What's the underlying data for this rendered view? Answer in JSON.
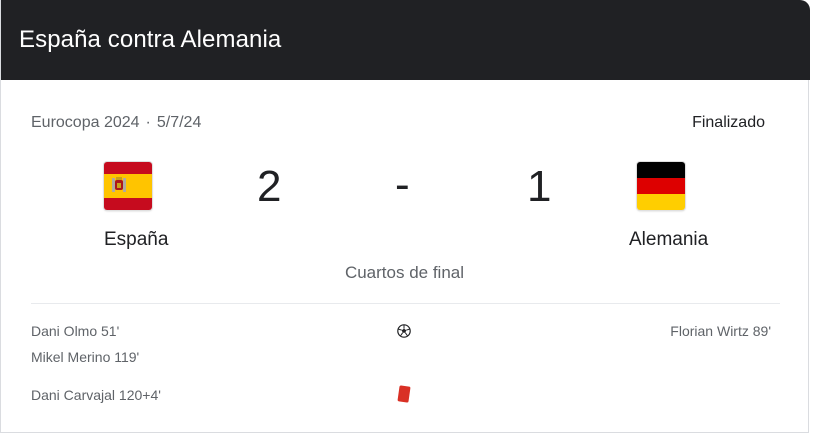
{
  "header": {
    "title": "España contra Alemania"
  },
  "match": {
    "competition": "Eurocopa 2024",
    "separator": "·",
    "date": "5/7/24",
    "status": "Finalizado",
    "round": "Cuartos de final",
    "score_separator": "-"
  },
  "home": {
    "name": "España",
    "score": "2",
    "flag_icon": "spain-flag-icon"
  },
  "away": {
    "name": "Alemania",
    "score": "1",
    "flag_icon": "germany-flag-icon"
  },
  "events": {
    "goals": {
      "icon": "soccer-ball-icon",
      "home": [
        "Dani Olmo 51'",
        "Mikel Merino 119'"
      ],
      "away": [
        "Florian Wirtz 89'"
      ]
    },
    "red_cards": {
      "icon": "red-card-icon",
      "color": "#d93025",
      "home": [
        "Dani Carvajal 120+4'"
      ],
      "away": []
    }
  },
  "colors": {
    "header_bg": "#202124",
    "spain_red": "#c60b1e",
    "spain_yellow": "#ffc400",
    "germany_black": "#000000",
    "germany_red": "#dd0000",
    "germany_gold": "#ffce00"
  }
}
